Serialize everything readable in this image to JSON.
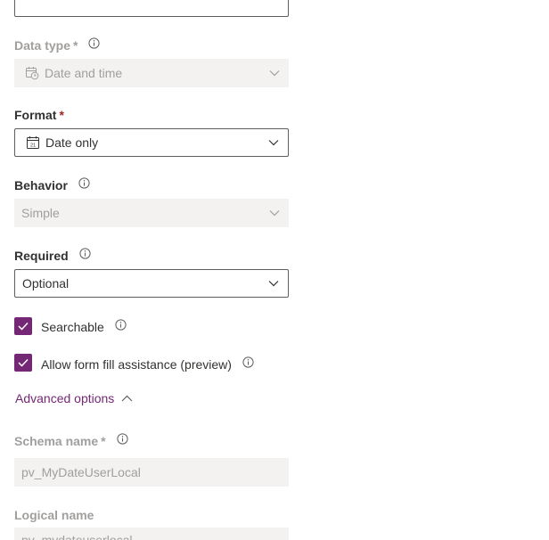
{
  "data_type": {
    "label": "Data type",
    "required_mark": "*",
    "value": "Date and time",
    "icon": "calendar-clock-icon"
  },
  "format": {
    "label": "Format",
    "required_mark": "*",
    "value": "Date only",
    "icon": "calendar-icon"
  },
  "behavior": {
    "label": "Behavior",
    "value": "Simple"
  },
  "required": {
    "label": "Required",
    "value": "Optional"
  },
  "searchable": {
    "label": "Searchable",
    "checked": true
  },
  "form_fill": {
    "label": "Allow form fill assistance (preview)",
    "checked": true
  },
  "advanced_options": {
    "label": "Advanced options",
    "expanded": true
  },
  "schema_name": {
    "label": "Schema name",
    "required_mark": "*",
    "value": "pv_MyDateUserLocal"
  },
  "logical_name": {
    "label": "Logical name",
    "value": "pv_mydateuserlocal"
  },
  "colors": {
    "accent": "#742774",
    "disabled_text": "#a19f9d",
    "disabled_bg": "#f3f2f1",
    "required_star": "#a4262c"
  }
}
